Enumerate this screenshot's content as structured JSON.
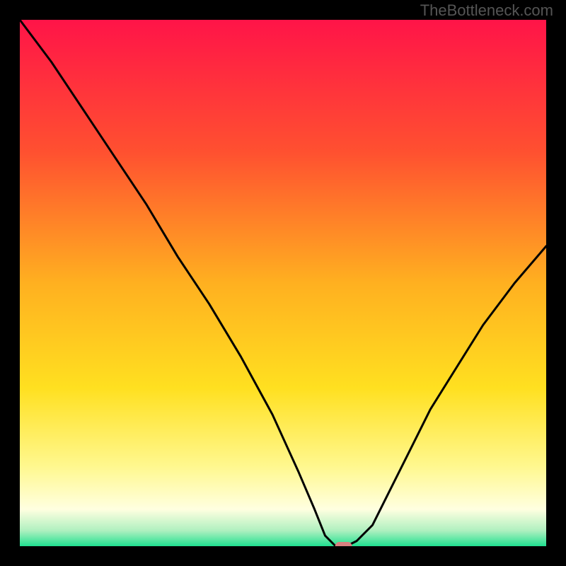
{
  "watermark": "TheBottleneck.com",
  "chart_data": {
    "type": "line",
    "title": "",
    "xlabel": "",
    "ylabel": "",
    "xlim": [
      0,
      100
    ],
    "ylim": [
      0,
      100
    ],
    "gradient_stops": [
      {
        "offset": 0,
        "color": "#ff1448"
      },
      {
        "offset": 25,
        "color": "#ff5030"
      },
      {
        "offset": 50,
        "color": "#ffb020"
      },
      {
        "offset": 70,
        "color": "#ffe020"
      },
      {
        "offset": 85,
        "color": "#fff890"
      },
      {
        "offset": 93,
        "color": "#ffffe0"
      },
      {
        "offset": 97,
        "color": "#b0f0c0"
      },
      {
        "offset": 100,
        "color": "#20e090"
      }
    ],
    "series": [
      {
        "name": "bottleneck-curve",
        "color": "#000000",
        "x": [
          0,
          6,
          12,
          18,
          24,
          30,
          36,
          42,
          48,
          53,
          56,
          58,
          60,
          62,
          64,
          67,
          70,
          74,
          78,
          83,
          88,
          94,
          100
        ],
        "values": [
          100,
          92,
          83,
          74,
          65,
          55,
          46,
          36,
          25,
          14,
          7,
          2,
          0,
          0,
          1,
          4,
          10,
          18,
          26,
          34,
          42,
          50,
          57
        ]
      }
    ],
    "marker": {
      "x": 61.5,
      "y": 0,
      "width_pct": 3.2,
      "height_pct": 1.6,
      "color": "#d88080"
    }
  }
}
